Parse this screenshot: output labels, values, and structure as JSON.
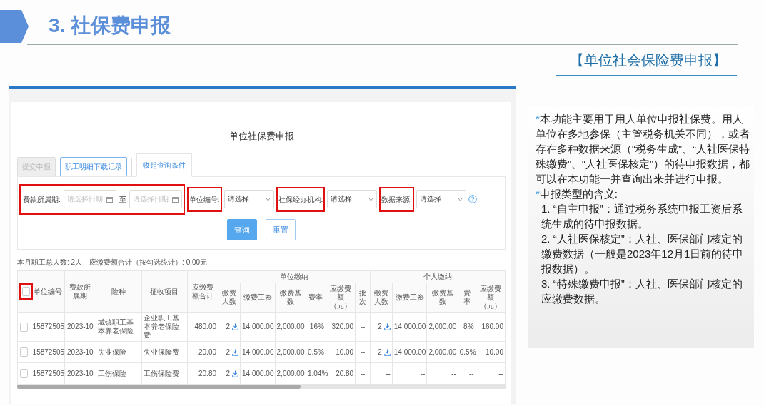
{
  "slide": {
    "title": "3. 社保费申报",
    "subtitle": "【单位社会保险费申报】"
  },
  "app": {
    "heading": "单位社保费申报",
    "toolbar": [
      {
        "label": "提交申报",
        "disabled": true
      },
      {
        "label": "职工明细下载记录",
        "disabled": false
      }
    ],
    "collapse_tab": "收起查询条件",
    "filters": [
      {
        "kind": "daterange",
        "label": "费款所属期:",
        "placeholder_from": "请选择日期",
        "separator": "至",
        "placeholder_to": "请选择日期",
        "highlighted": true
      },
      {
        "kind": "select",
        "label": "单位编号:",
        "value": "请选择",
        "highlighted": true
      },
      {
        "kind": "select",
        "label": "社保经办机构:",
        "value": "请选择",
        "highlighted": true
      },
      {
        "kind": "select",
        "label": "数据来源:",
        "value": "请选择",
        "highlighted": true,
        "help": true
      }
    ],
    "search_button": "查询",
    "reset_button": "重置",
    "summary": "本月职工总人数: 2人　应缴费额合计（按勾选统计）: 0.00元",
    "table": {
      "header_checkbox": {
        "checked": false,
        "highlighted": true
      },
      "columns": [
        "单位编号",
        "费款所属期",
        "险种",
        "征收项目",
        "应缴费额合计"
      ],
      "groups": [
        {
          "label": "单位缴纳",
          "columns": [
            "缴费人数",
            "缴费工资",
            "缴费基数",
            "费率",
            "应缴费额（元）",
            "批次"
          ]
        },
        {
          "label": "个人缴纳",
          "columns": [
            "缴费人数",
            "缴费工资",
            "缴费基数",
            "费率",
            "应缴费额（元）"
          ]
        }
      ],
      "rows": [
        {
          "checked": false,
          "cells": [
            "15872505",
            "2023-10",
            "城镇职工基本养老保险",
            "企业职工基本养老保险费",
            "480.00",
            {
              "text": "2",
              "download": true
            },
            "14,000.00",
            "2,000.00",
            "16%",
            "320.00",
            "--",
            {
              "text": "2",
              "download": true
            },
            "14,000.00",
            "2,000.00",
            "8%",
            "160.00"
          ]
        },
        {
          "checked": false,
          "cells": [
            "15872505",
            "2023-10",
            "失业保险",
            "失业保险费",
            "20.00",
            {
              "text": "2",
              "download": true
            },
            "14,000.00",
            "2,000.00",
            "0.5%",
            "10.00",
            "--",
            {
              "text": "2",
              "download": true
            },
            "14,000.00",
            "2,000.00",
            "0.5%",
            "10.00"
          ]
        },
        {
          "checked": false,
          "cells": [
            "15872505",
            "2023-10",
            "工伤保险",
            "工伤保险费",
            "20.80",
            {
              "text": "2",
              "download": true
            },
            "14,000.00",
            "2,000.00",
            "1.04%",
            "20.80",
            "--",
            "--",
            "--",
            "--",
            "--",
            "--"
          ]
        }
      ]
    }
  },
  "notes": [
    {
      "kind": "bullet",
      "mark": "*",
      "text": "本功能主要用于用人单位申报社保费。用人单位在多地参保（主管税务机关不同），或者存在多种数据来源（“税务生成”、“人社医保特殊缴费”、“人社医保核定”）的待申报数据，都可以在本功能一并查询出来并进行申报。"
    },
    {
      "kind": "bullet",
      "mark": "*",
      "text": "申报类型的含义:"
    },
    {
      "kind": "item",
      "text": "1. “自主申报”：通过税务系统申报工资后系统生成的待申报数据。"
    },
    {
      "kind": "item",
      "text": "2. “人社医保核定”：人社、医保部门核定的缴费数据（一般是2023年12月1日前的待申报数据）。"
    },
    {
      "kind": "item",
      "text": "3. “特殊缴费申报”：人社、医保部门核定的应缴费数据。"
    }
  ]
}
